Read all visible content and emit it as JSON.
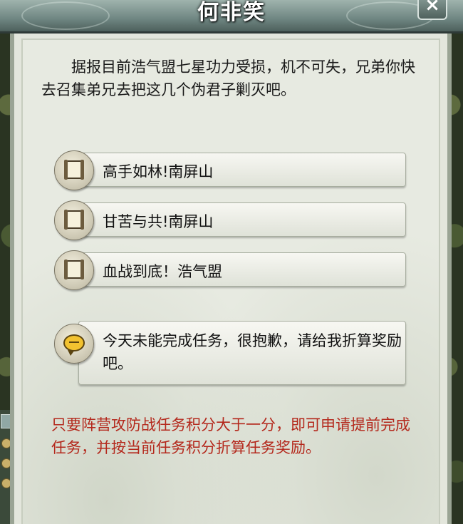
{
  "dialog": {
    "title": "何非笑",
    "close_label": "×"
  },
  "intro_text": "　　据报目前浩气盟七星功力受损，机不可失，兄弟你快去召集弟兄去把这几个伪君子剿灭吧。",
  "options": [
    {
      "label": "高手如林!南屏山",
      "icon": "scroll-icon"
    },
    {
      "label": "甘苦与共!南屏山",
      "icon": "scroll-icon"
    },
    {
      "label": "血战到底！浩气盟",
      "icon": "scroll-icon"
    }
  ],
  "complete_option": {
    "label": "今天未能完成任务，很抱歉，请给我折算奖励吧。",
    "icon": "speech-bubble-icon"
  },
  "notice_text": "只要阵营攻防战任务积分大于一分，即可申请提前完成任务，并按当前任务积分折算任务奖励。",
  "colors": {
    "notice": "#b4281c",
    "parchment": "#e7eae1",
    "title_bar": "#6f8682"
  }
}
